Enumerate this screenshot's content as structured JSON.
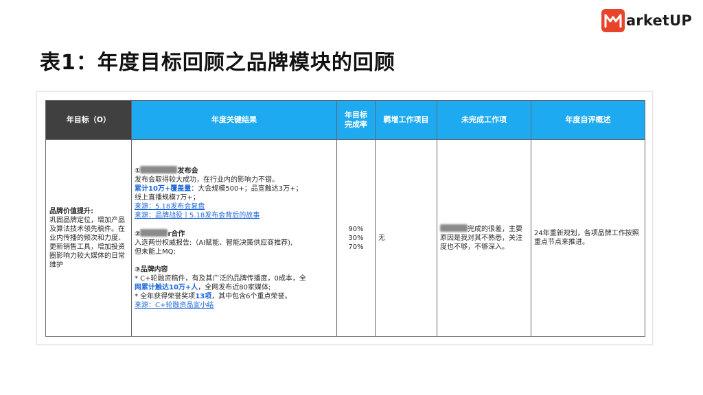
{
  "brand": {
    "logo_text": "arketUP",
    "accent": "#e8442b"
  },
  "title": "表1：年度目标回顾之品牌模块的回顾",
  "table": {
    "headers": {
      "goal": "年目标（O）",
      "key_results": "年度关键结果",
      "completion_rate_line1": "年目标",
      "completion_rate_line2": "完成率",
      "added_items": "羁增工作项目",
      "unfinished": "未完成工作项",
      "self_review": "年度自评概述"
    },
    "header_colors": {
      "dark": "#404040",
      "blue": "#1eaaf0"
    },
    "row": {
      "goal_title": "品牌价值提升:",
      "goal_desc": "巩固品牌定位，增加产品及算法技术领先稿件。在业内传播的频次和力度、更新销售工具，增加投资圈影响力较大媒体的日常维护",
      "kr1_heading_num": "①",
      "kr1_heading_suffix": "发布会",
      "kr1_line1": "发布会取得较大成功，在行业内的影响力不错。",
      "kr1_line2_highlight": "累计10万+覆盖量",
      "kr1_line2_rest": "：大会规模500+；品宣触达3万+；",
      "kr1_line3": "线上直播规模7万+；",
      "kr1_link1": "来源：5.18发布会复盘",
      "kr1_link2": "来源：品牌战役丨5.18发布会背后的故事",
      "kr2_heading_num": "②",
      "kr2_heading_suffix": "r合作",
      "kr2_line1": "入选两份权威报告:（AI赋能、智能决策供应商推荐),",
      "kr2_line2": "但未能上MQ;",
      "kr3_heading": "③品牌内容",
      "kr3_line1": "* C+轮融资稿件，有及其广泛的品牌传播度，0成本，全",
      "kr3_line2_highlight": "网累计触达10万+人",
      "kr3_line2_rest": "，全网发布近80家媒体;",
      "kr3_line3_a": "* 全年获得荣誉奖项",
      "kr3_line3_highlight": "13项",
      "kr3_line3_b": "，其中包含6个重点荣誉。",
      "kr3_link": "来源：C+轮融资品宣小结",
      "rates": [
        "90%",
        "30%",
        "70%"
      ],
      "added": "无",
      "unfinished_rest": "完成的很差，主要原因是我对其不熟悉，关注度也不够，不够深入。",
      "self_review": "24年重新规划，各项品牌工作按照重点节点来推进。"
    }
  }
}
